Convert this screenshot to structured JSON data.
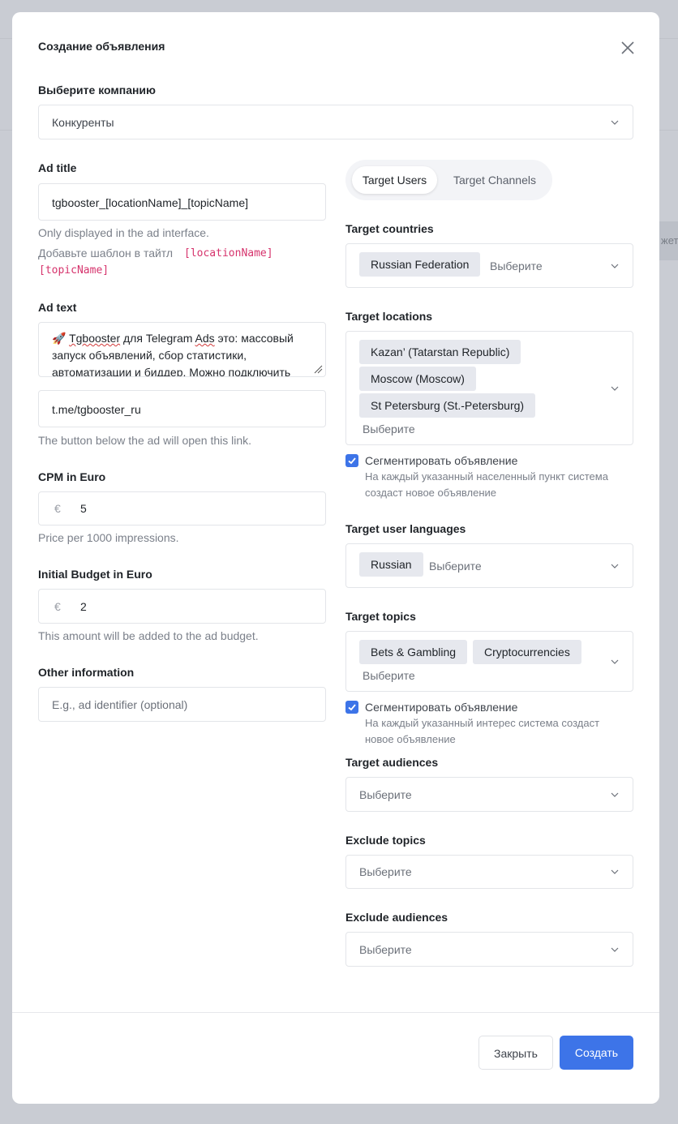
{
  "background": {
    "partial_text": "жет"
  },
  "modal": {
    "title": "Создание объявления",
    "company": {
      "label": "Выберите компанию",
      "value": "Конкуренты"
    },
    "ad_title": {
      "label": "Ad title",
      "value": "tgbooster_[locationName]_[topicName]",
      "hint": "Only displayed in the ad interface.",
      "template_hint": "Добавьте шаблон в тайтл",
      "template_token_1": "[locationName]",
      "template_token_2": "[topicName]"
    },
    "ad_text": {
      "label": "Ad text",
      "emoji": "🚀",
      "word1": "Tgbooster",
      "line1_mid": " для Telegram ",
      "word2": "Ads",
      "line1_end": " это: массовый",
      "line2": "запуск объявлений, сбор статистики,",
      "line3": "автоматизации и биддер. Можно подключить"
    },
    "link": {
      "value": "t.me/tgbooster_ru",
      "hint": "The button below the ad will open this link."
    },
    "cpm": {
      "label": "CPM in Euro",
      "currency": "€",
      "value": "5",
      "hint": "Price per 1000 impressions."
    },
    "budget": {
      "label": "Initial Budget in Euro",
      "currency": "€",
      "value": "2",
      "hint": "This amount will be added to the ad budget."
    },
    "other": {
      "label": "Other information",
      "placeholder": "E.g., ad identifier (optional)"
    },
    "tabs": {
      "active": "Target Users",
      "inactive": "Target Channels"
    },
    "countries": {
      "label": "Target countries",
      "chips": [
        "Russian Federation"
      ],
      "placeholder": "Выберите"
    },
    "locations": {
      "label": "Target locations",
      "chips": [
        "Kazan’ (Tatarstan Republic)",
        "Moscow (Moscow)",
        "St Petersburg (St.-Petersburg)"
      ],
      "placeholder": "Выберите",
      "segment_label": "Сегментировать объявление",
      "segment_desc_1": "На каждый указанный населенный пункт система",
      "segment_desc_2": "создаст новое объявление"
    },
    "languages": {
      "label": "Target user languages",
      "chips": [
        "Russian"
      ],
      "placeholder": "Выберите"
    },
    "topics": {
      "label": "Target topics",
      "chips": [
        "Bets & Gambling",
        "Cryptocurrencies"
      ],
      "placeholder": "Выберите",
      "segment_label": "Сегментировать объявление",
      "segment_desc_1": "На каждый указанный интерес система создаст",
      "segment_desc_2": "новое объявление"
    },
    "audiences": {
      "label": "Target audiences",
      "placeholder": "Выберите"
    },
    "exclude_topics": {
      "label": "Exclude topics",
      "placeholder": "Выберите"
    },
    "exclude_audiences": {
      "label": "Exclude audiences",
      "placeholder": "Выберите"
    },
    "footer": {
      "close_label": "Закрыть",
      "create_label": "Создать"
    },
    "colors": {
      "accent": "#3d74e8",
      "chip_bg": "#e6e8ee",
      "code": "#d6336c"
    }
  }
}
